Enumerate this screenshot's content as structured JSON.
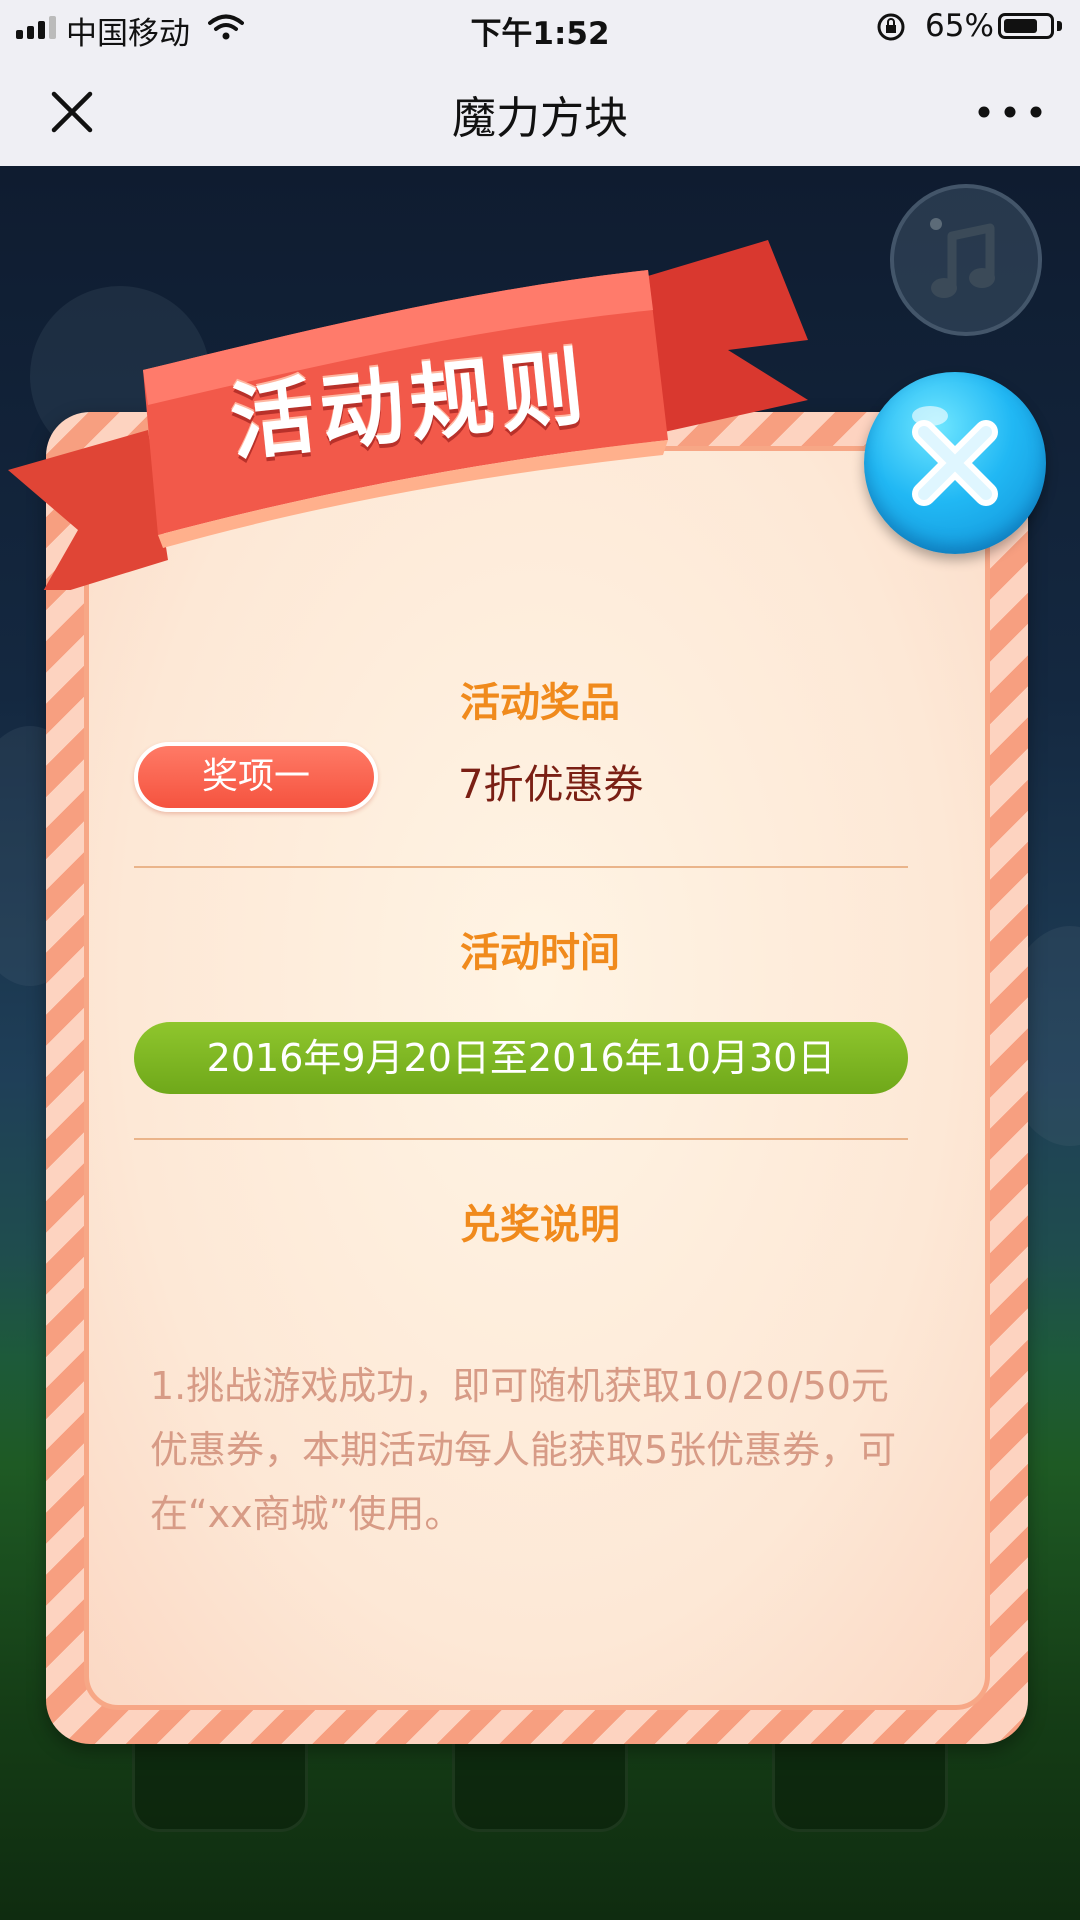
{
  "status_bar": {
    "carrier": "中国移动",
    "time": "下午1:52",
    "battery_pct": "65%",
    "battery_level": 0.65
  },
  "nav": {
    "title": "魔力方块"
  },
  "modal": {
    "ribbon_title": "活动规则",
    "prize_section_title": "活动奖品",
    "prize_label": "奖项一",
    "prize_value": "7折优惠券",
    "time_section_title": "活动时间",
    "time_range": "2016年9月20日至2016年10月30日",
    "redeem_section_title": "兑奖说明",
    "redeem_text": "1.挑战游戏成功，即可随机获取10/20/50元优惠券，本期活动每人能获取5张优惠券，可在“xx商城”使用。"
  },
  "colors": {
    "section_title": "#f08a1c",
    "prize_pill": "#f5533f",
    "date_pill": "#7db523",
    "rules_text": "#d79b86",
    "close_button": "#21b8f4"
  },
  "icons": {
    "nav_close": "close-icon",
    "nav_more": "more-dots-icon",
    "music": "music-note-icon",
    "modal_close": "close-icon"
  }
}
